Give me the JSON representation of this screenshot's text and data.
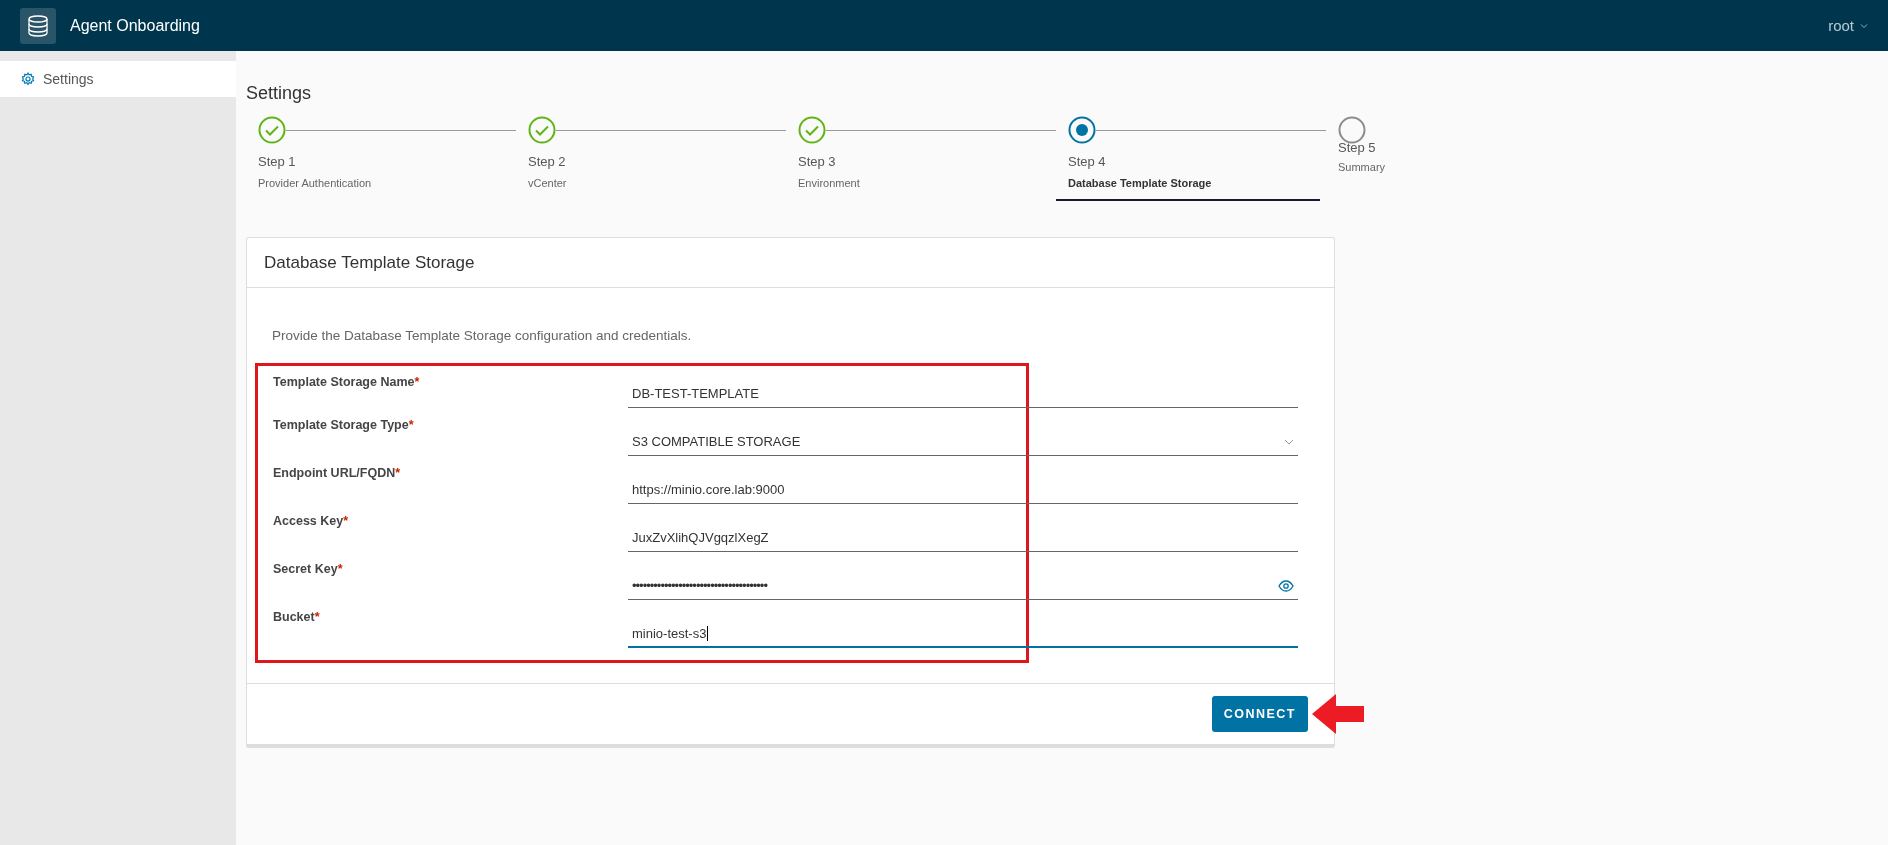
{
  "header": {
    "title": "Agent Onboarding",
    "user": "root"
  },
  "sidebar": {
    "items": [
      {
        "label": "Settings",
        "selected": true
      }
    ]
  },
  "page": {
    "title": "Settings"
  },
  "stepper": {
    "steps": [
      {
        "step": "Step 1",
        "label": "Provider Authentication",
        "kind": "complete",
        "selected": false
      },
      {
        "step": "Step 2",
        "label": "vCenter",
        "kind": "complete",
        "selected": false
      },
      {
        "step": "Step 3",
        "label": "Environment",
        "kind": "complete",
        "selected": false
      },
      {
        "step": "Step 4",
        "label": "Database Template Storage",
        "kind": "current",
        "selected": true
      },
      {
        "step": "Step 5",
        "label": "Summary",
        "kind": "pending",
        "selected": false
      }
    ]
  },
  "card": {
    "title": "Database Template Storage",
    "description": "Provide the Database Template Storage configuration and credentials.",
    "fields": [
      {
        "label": "Template Storage Name",
        "required": "*",
        "value": "DB-TEST-TEMPLATE",
        "kind": "text",
        "focused": false
      },
      {
        "label": "Template Storage Type",
        "required": "*",
        "value": "S3 COMPATIBLE STORAGE",
        "kind": "select",
        "focused": false
      },
      {
        "label": "Endpoint URL/FQDN",
        "required": "*",
        "value": "https://minio.core.lab:9000",
        "kind": "text",
        "focused": false
      },
      {
        "label": "Access Key",
        "required": "*",
        "value": "JuxZvXlihQJVgqzlXegZ",
        "kind": "text",
        "focused": false
      },
      {
        "label": "Secret Key",
        "required": "*",
        "value": "••••••••••••••••••••••••••••••••••••••",
        "kind": "password",
        "focused": false
      },
      {
        "label": "Bucket",
        "required": "*",
        "value": "minio-test-s3",
        "kind": "text",
        "focused": true
      }
    ],
    "button": "CONNECT"
  }
}
